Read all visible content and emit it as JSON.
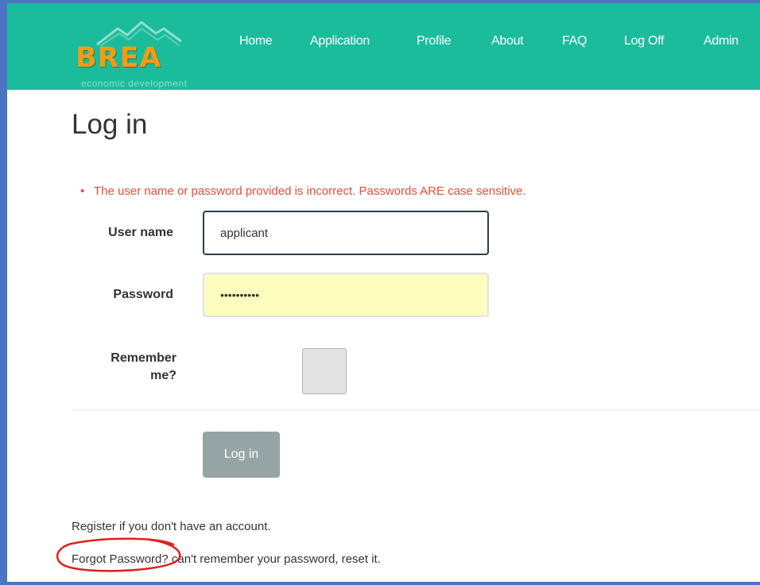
{
  "brand": {
    "name": "BREA",
    "tagline": "economic development"
  },
  "nav": [
    {
      "label": "Home"
    },
    {
      "label": "Application"
    },
    {
      "label": "Profile"
    },
    {
      "label": "About"
    },
    {
      "label": "FAQ"
    },
    {
      "label": "Log Off"
    },
    {
      "label": "Admin"
    }
  ],
  "page": {
    "title": "Log in",
    "error_message": "The user name or password provided is incorrect. Passwords ARE case sensitive."
  },
  "form": {
    "username_label": "User name",
    "username_value": "applicant",
    "password_label": "Password",
    "password_value": "••••••••••",
    "remember_label_line1": "Remember",
    "remember_label_line2": "me?",
    "remember_checked": false,
    "submit_label": "Log in"
  },
  "footer": {
    "register_link": "Register",
    "register_text": " if you don't have an account.",
    "forgot_link": "Forgot Password?",
    "forgot_text": " can't remember your password, reset it."
  },
  "colors": {
    "navbar": "#1abc9c",
    "brand": "#f39c12",
    "error": "#e74c3c",
    "button": "#95a5a6",
    "autofill": "#fdfdbf",
    "annotation_circle": "#e0201a",
    "frame": "#4a74c4"
  }
}
